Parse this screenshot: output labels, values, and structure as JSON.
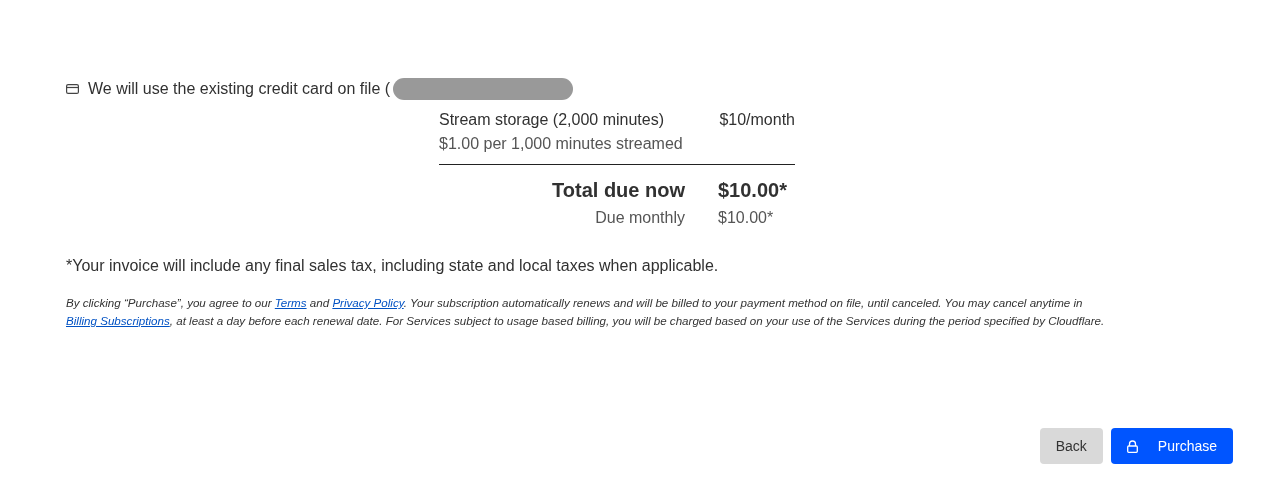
{
  "payment_notice": "We will use the existing credit card on file (",
  "line_items": [
    {
      "name": "Stream storage (2,000 minutes)",
      "price": "$10/month",
      "detail": "$1.00 per 1,000 minutes streamed"
    }
  ],
  "totals": [
    {
      "kind": "primary",
      "label": "Total due now",
      "amount": "$10.00*"
    },
    {
      "kind": "secondary",
      "label": "Due monthly",
      "amount": "$10.00*"
    }
  ],
  "tax_note": "*Your invoice will include any final sales tax, including state and local taxes when applicable.",
  "legal": [
    {
      "kind": "text",
      "text": "By clicking “Purchase”, you agree to our "
    },
    {
      "kind": "link",
      "text": "Terms"
    },
    {
      "kind": "text",
      "text": " and "
    },
    {
      "kind": "link",
      "text": "Privacy Policy"
    },
    {
      "kind": "text",
      "text": ". Your subscription automatically renews and will be billed to your payment method on file, until canceled. You may cancel anytime in "
    },
    {
      "kind": "link",
      "text": "Billing Subscriptions"
    },
    {
      "kind": "text",
      "text": ", at least a day before each renewal date. For Services subject to usage based billing, you will be charged based on your use of the Services during the period specified by Cloudflare."
    }
  ],
  "buttons": [
    {
      "kind": "secondary",
      "label": "Back"
    },
    {
      "kind": "primary",
      "label": "Purchase"
    }
  ]
}
